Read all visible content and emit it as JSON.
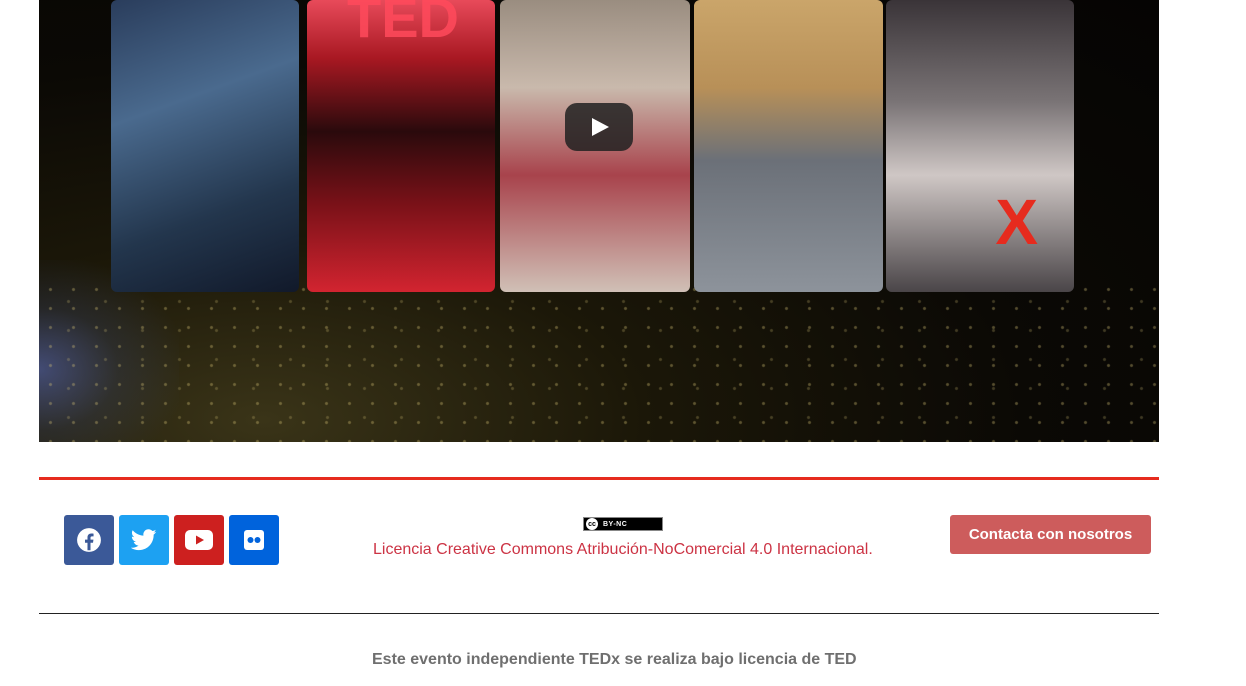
{
  "video": {
    "play_label": "Play",
    "panel_ted_text": "TED",
    "panel_x_text": "X"
  },
  "social": [
    {
      "name": "facebook",
      "icon": "facebook-icon",
      "color": "#3b5998"
    },
    {
      "name": "twitter",
      "icon": "twitter-icon",
      "color": "#1da1f2"
    },
    {
      "name": "youtube",
      "icon": "youtube-icon",
      "color": "#cd201f"
    },
    {
      "name": "flickr",
      "icon": "flickr-icon",
      "color": "#0063dc"
    }
  ],
  "license": {
    "badge_cc": "cc",
    "badge_text": "BY-NC",
    "link_text": "Licencia Creative Commons Atribución-NoComercial 4.0 Internacional."
  },
  "contact": {
    "button_label": "Contacta con nosotros"
  },
  "footer": {
    "text": "Este evento independiente TEDx se realiza bajo licencia de TED"
  },
  "colors": {
    "accent_red": "#e62b1e",
    "link_red": "#cc3344",
    "button_bg": "#cd5c5c"
  }
}
